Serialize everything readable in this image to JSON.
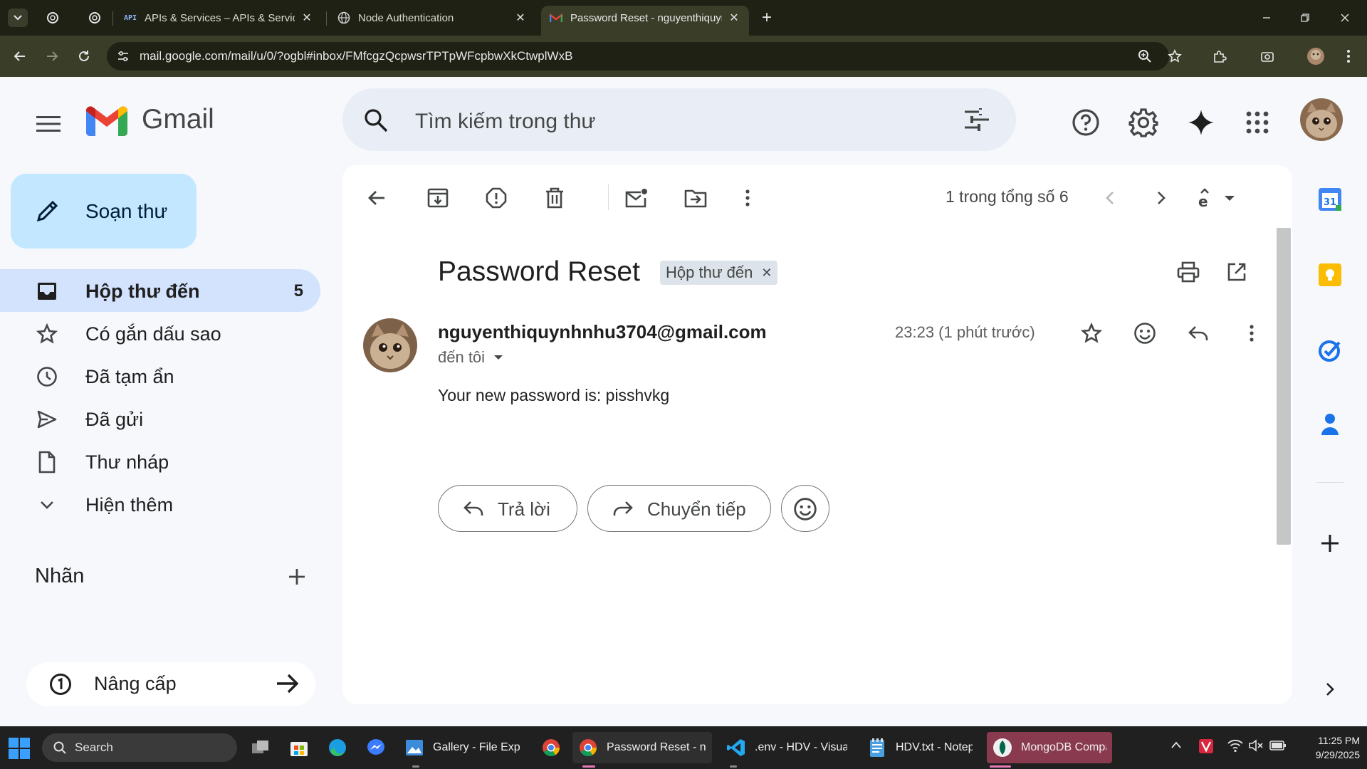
{
  "browser": {
    "tabs": [
      {
        "title": "APIs & Services – APIs & Services",
        "favicon": "api-icon"
      },
      {
        "title": "Node Authentication",
        "favicon": "globe-icon"
      },
      {
        "title": "Password Reset - nguyenthiquynhnhu",
        "favicon": "gmail-icon",
        "active": true
      }
    ],
    "url": "mail.google.com/mail/u/0/?ogbl#inbox/FMfcgzQcpwsrTPTpWFcpbwXkCtwplWxB"
  },
  "gmail": {
    "wordmark": "Gmail",
    "search_placeholder": "Tìm kiếm trong thư",
    "compose_label": "Soạn thư",
    "nav": [
      {
        "label": "Hộp thư đến",
        "count": "5",
        "icon": "inbox-icon",
        "active": true
      },
      {
        "label": "Có gắn dấu sao",
        "icon": "star-icon"
      },
      {
        "label": "Đã tạm ẩn",
        "icon": "clock-icon"
      },
      {
        "label": "Đã gửi",
        "icon": "send-icon"
      },
      {
        "label": "Thư nháp",
        "icon": "draft-icon"
      },
      {
        "label": "Hiện thêm",
        "icon": "chevron-down-icon"
      }
    ],
    "labels_heading": "Nhãn",
    "upgrade_label": "Nâng cấp",
    "pager_text": "1 trong tổng số 6",
    "message": {
      "subject": "Password Reset",
      "label_chip": "Hộp thư đến",
      "sender": "nguyenthiquynhnhu3704@gmail.com",
      "to": "đến tôi",
      "time": "23:23 (1 phút trước)",
      "body": "Your new password is: pisshvkg"
    },
    "actions": {
      "reply": "Trả lời",
      "forward": "Chuyển tiếp"
    }
  },
  "taskbar": {
    "search_label": "Search",
    "apps": [
      {
        "title": "Gallery - File Explorer"
      },
      {
        "title": "Password Reset - nguyenthiquynhnhu"
      },
      {
        "title": ".env - HDV - Visual Studio Code"
      },
      {
        "title": "HDV.txt - Notepad"
      },
      {
        "title": "MongoDB Compass"
      }
    ],
    "time": "11:25 PM",
    "date": "9/29/2025"
  },
  "colors": {
    "compose_bg": "#c2e7ff",
    "nav_active_bg": "#d3e3fd",
    "search_bg": "#e9eef6",
    "browser_frame": "#1f2114"
  }
}
